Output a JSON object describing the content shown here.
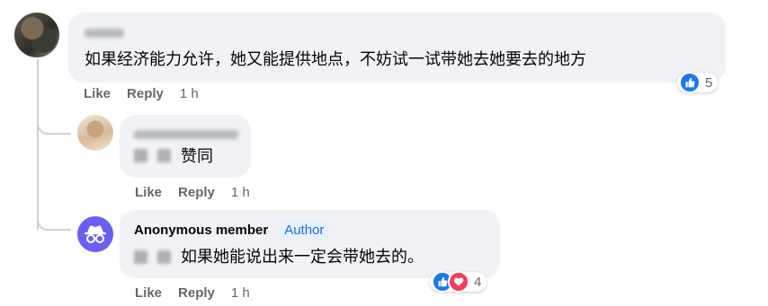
{
  "comments": [
    {
      "text": "如果经济能力允许，她又能提供地点，不妨试一试带她去她要去的地方",
      "actions": {
        "like": "Like",
        "reply": "Reply",
        "time": "1 h"
      },
      "reactions": {
        "count": "5",
        "icons": [
          "like-icon"
        ]
      }
    },
    {
      "text": "赞同",
      "actions": {
        "like": "Like",
        "reply": "Reply",
        "time": "1 h"
      }
    },
    {
      "name": "Anonymous member",
      "badge": "Author",
      "text": "如果她能说出来一定会带她去的。",
      "actions": {
        "like": "Like",
        "reply": "Reply",
        "time": "1 h"
      },
      "reactions": {
        "count": "4",
        "icons": [
          "like-icon",
          "heart-icon"
        ]
      }
    }
  ],
  "colors": {
    "bubble": "#f0f2f5",
    "thread_line": "#ced0d4",
    "muted": "#65676b",
    "like_blue": "#1877f2",
    "love_red": "#f33e58",
    "anon_purple": "#6a5ff2",
    "badge_bg": "#e7f0fd",
    "badge_text": "#1a6ed8"
  }
}
